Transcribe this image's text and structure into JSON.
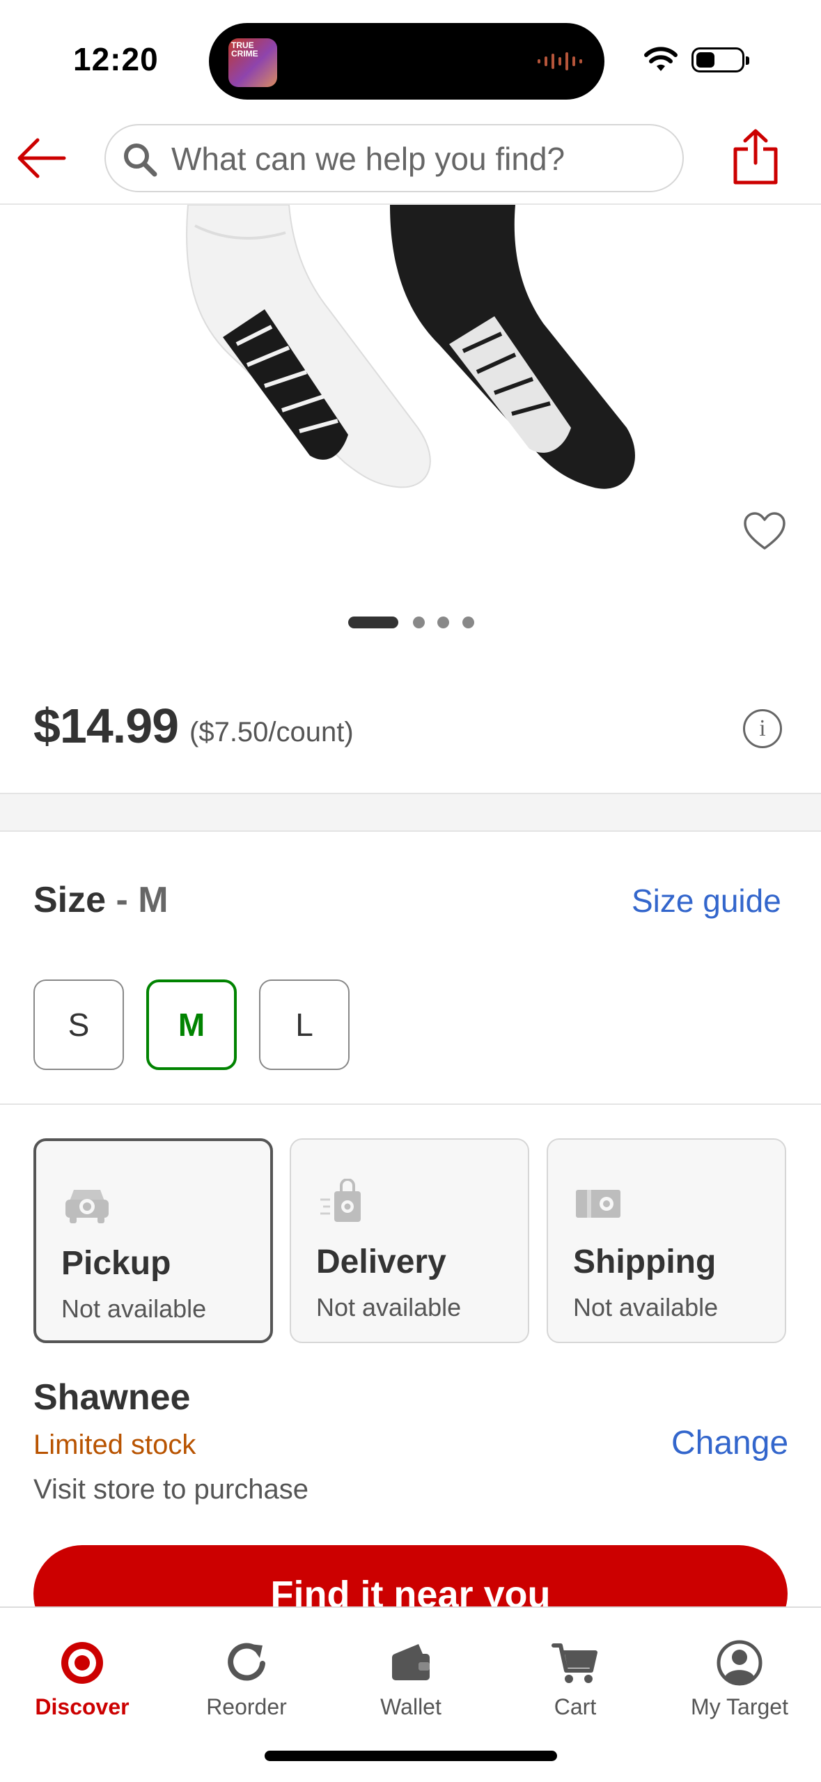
{
  "status_bar": {
    "time": "12:20",
    "live_activity_label": "TRUE CRIME"
  },
  "header": {
    "search_placeholder": "What can we help you find?"
  },
  "product": {
    "price": "$14.99",
    "unit_price": "($7.50/count)",
    "image_pages": 4,
    "image_current_page": 1
  },
  "size": {
    "label": "Size",
    "separator": " - ",
    "selected": "M",
    "guide_label": "Size guide",
    "options": [
      "S",
      "M",
      "L"
    ]
  },
  "fulfillment": [
    {
      "title": "Pickup",
      "status": "Not available",
      "icon": "car-icon",
      "selected": true
    },
    {
      "title": "Delivery",
      "status": "Not available",
      "icon": "shopping-bag-icon",
      "selected": false
    },
    {
      "title": "Shipping",
      "status": "Not available",
      "icon": "shipping-box-icon",
      "selected": false
    }
  ],
  "store": {
    "name": "Shawnee",
    "stock": "Limited stock",
    "note": "Visit store to purchase",
    "change_label": "Change"
  },
  "cta": {
    "label": "Find it near you"
  },
  "tabs": [
    {
      "label": "Discover",
      "icon": "target-logo-icon",
      "active": true
    },
    {
      "label": "Reorder",
      "icon": "reorder-icon",
      "active": false
    },
    {
      "label": "Wallet",
      "icon": "wallet-icon",
      "active": false
    },
    {
      "label": "Cart",
      "icon": "cart-icon",
      "active": false
    },
    {
      "label": "My Target",
      "icon": "profile-icon",
      "active": false
    }
  ],
  "colors": {
    "brand_red": "#cc0000",
    "link_blue": "#3366cc",
    "selected_green": "#008300",
    "stock_orange": "#b85300"
  }
}
